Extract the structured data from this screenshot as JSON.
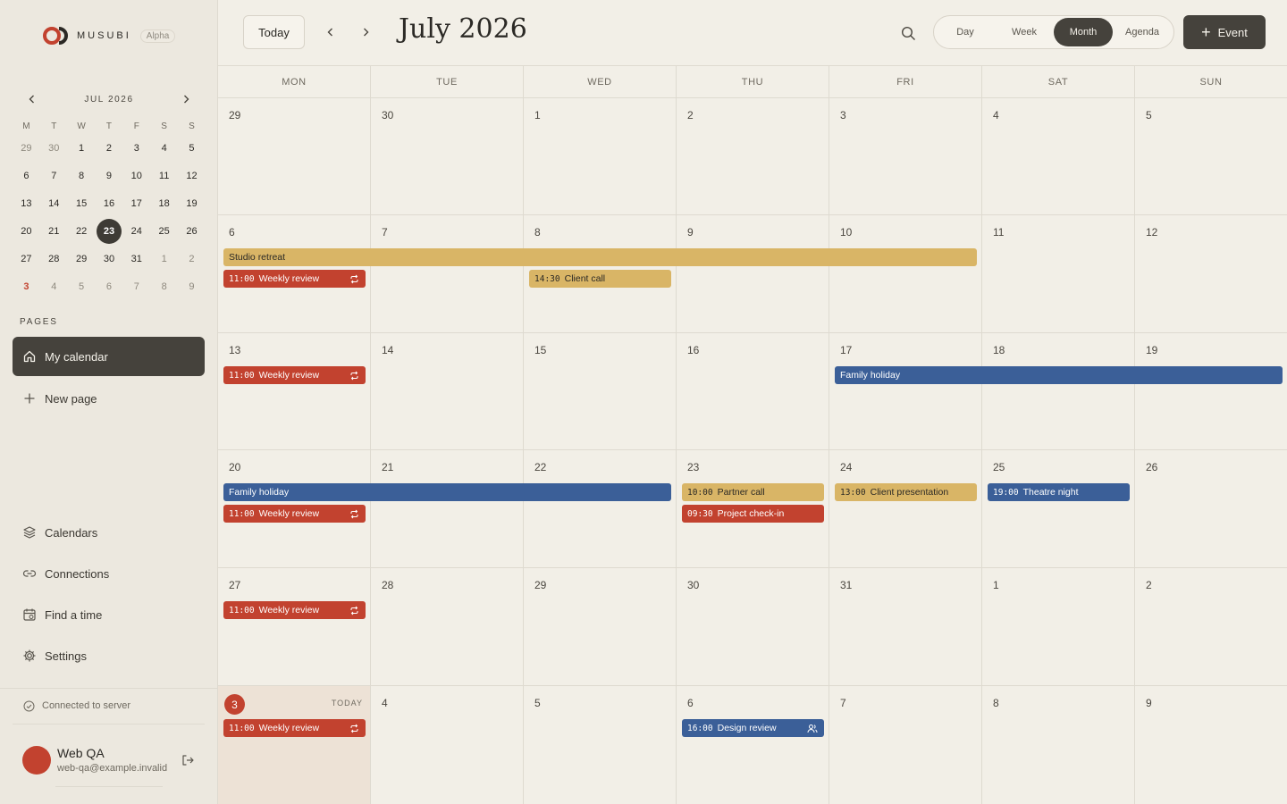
{
  "app": {
    "name": "MUSUBI",
    "badge": "Alpha"
  },
  "colors": {
    "accent_red": "#c2422f",
    "gold": "#d9b566",
    "blue": "#3b5f98",
    "dark": "#45423c"
  },
  "mini_calendar": {
    "title": "JUL 2026",
    "dow": [
      "M",
      "T",
      "W",
      "T",
      "F",
      "S",
      "S"
    ],
    "weeks": [
      [
        "29",
        "30",
        "1",
        "2",
        "3",
        "4",
        "5"
      ],
      [
        "6",
        "7",
        "8",
        "9",
        "10",
        "11",
        "12"
      ],
      [
        "13",
        "14",
        "15",
        "16",
        "17",
        "18",
        "19"
      ],
      [
        "20",
        "21",
        "22",
        "23",
        "24",
        "25",
        "26"
      ],
      [
        "27",
        "28",
        "29",
        "30",
        "31",
        "1",
        "2"
      ],
      [
        "3",
        "4",
        "5",
        "6",
        "7",
        "8",
        "9"
      ]
    ],
    "selected": "23",
    "today": "3"
  },
  "sidebar": {
    "pages_label": "PAGES",
    "pages": [
      {
        "label": "My calendar",
        "icon": "home-icon"
      },
      {
        "label": "New page",
        "icon": "plus-icon"
      }
    ],
    "bottom_nav": [
      {
        "label": "Calendars",
        "icon": "layers-icon"
      },
      {
        "label": "Connections",
        "icon": "link-icon"
      },
      {
        "label": "Find a time",
        "icon": "calendar-clock-icon"
      },
      {
        "label": "Settings",
        "icon": "gear-icon"
      }
    ],
    "status": "Connected to server",
    "user": {
      "name": "Web QA",
      "email": "web-qa@example.invalid"
    }
  },
  "header": {
    "today_label": "Today",
    "title": "July 2026",
    "views": [
      "Day",
      "Week",
      "Month",
      "Agenda"
    ],
    "active_view": "Month",
    "event_button": "Event"
  },
  "grid": {
    "dow": [
      "MON",
      "TUE",
      "WED",
      "THU",
      "FRI",
      "SAT",
      "SUN"
    ],
    "weeks": [
      [
        "29",
        "30",
        "1",
        "2",
        "3",
        "4",
        "5"
      ],
      [
        "6",
        "7",
        "8",
        "9",
        "10",
        "11",
        "12"
      ],
      [
        "13",
        "14",
        "15",
        "16",
        "17",
        "18",
        "19"
      ],
      [
        "20",
        "21",
        "22",
        "23",
        "24",
        "25",
        "26"
      ],
      [
        "27",
        "28",
        "29",
        "30",
        "31",
        "1",
        "2"
      ],
      [
        "3",
        "4",
        "5",
        "6",
        "7",
        "8",
        "9"
      ]
    ],
    "today_label": "TODAY"
  },
  "events": [
    {
      "week": 1,
      "day": 0,
      "span": 5,
      "lane": 0,
      "title": "Studio retreat",
      "time": "",
      "color": "gold"
    },
    {
      "week": 1,
      "day": 0,
      "span": 1,
      "lane": 1,
      "title": "Weekly review",
      "time": "11:00",
      "color": "red",
      "icon": "repeat-icon"
    },
    {
      "week": 1,
      "day": 2,
      "span": 1,
      "lane": 1,
      "title": "Client call",
      "time": "14:30",
      "color": "gold"
    },
    {
      "week": 2,
      "day": 0,
      "span": 1,
      "lane": 0,
      "title": "Weekly review",
      "time": "11:00",
      "color": "red",
      "icon": "repeat-icon"
    },
    {
      "week": 2,
      "day": 4,
      "span": 3,
      "lane": 0,
      "title": "Family holiday",
      "time": "",
      "color": "blue"
    },
    {
      "week": 3,
      "day": 0,
      "span": 3,
      "lane": 0,
      "title": "Family holiday",
      "time": "",
      "color": "blue"
    },
    {
      "week": 3,
      "day": 0,
      "span": 1,
      "lane": 1,
      "title": "Weekly review",
      "time": "11:00",
      "color": "red",
      "icon": "repeat-icon"
    },
    {
      "week": 3,
      "day": 3,
      "span": 1,
      "lane": 0,
      "title": "Partner call",
      "time": "10:00",
      "color": "gold"
    },
    {
      "week": 3,
      "day": 3,
      "span": 1,
      "lane": 1,
      "title": "Project check-in",
      "time": "09:30",
      "color": "red"
    },
    {
      "week": 3,
      "day": 4,
      "span": 1,
      "lane": 0,
      "title": "Client presentation",
      "time": "13:00",
      "color": "gold"
    },
    {
      "week": 3,
      "day": 5,
      "span": 1,
      "lane": 0,
      "title": "Theatre night",
      "time": "19:00",
      "color": "blue"
    },
    {
      "week": 4,
      "day": 0,
      "span": 1,
      "lane": 0,
      "title": "Weekly review",
      "time": "11:00",
      "color": "red",
      "icon": "repeat-icon"
    },
    {
      "week": 5,
      "day": 0,
      "span": 1,
      "lane": 0,
      "title": "Weekly review",
      "time": "11:00",
      "color": "red",
      "icon": "repeat-icon"
    },
    {
      "week": 5,
      "day": 3,
      "span": 1,
      "lane": 0,
      "title": "Design review",
      "time": "16:00",
      "color": "blue",
      "icon": "people-icon"
    }
  ]
}
